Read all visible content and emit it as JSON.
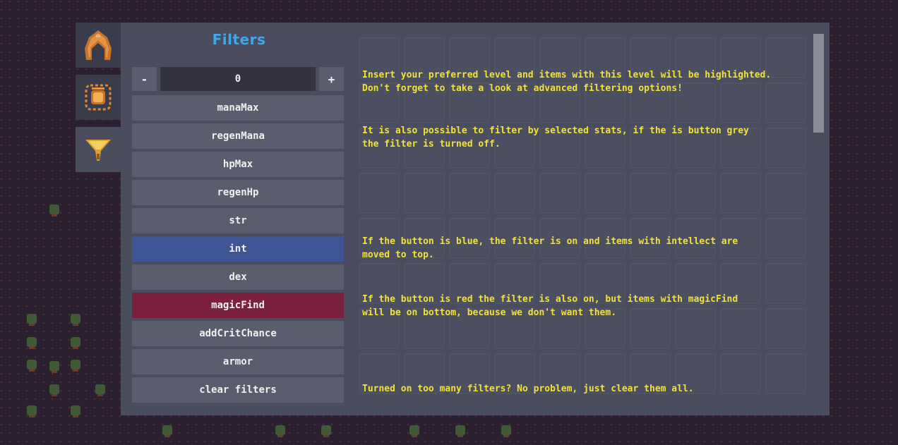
{
  "filters_title": "Filters",
  "level": {
    "minus_label": "-",
    "value": "0",
    "plus_label": "+"
  },
  "filter_buttons": [
    {
      "label": "manaMax",
      "state": "off"
    },
    {
      "label": "regenMana",
      "state": "off"
    },
    {
      "label": "hpMax",
      "state": "off"
    },
    {
      "label": "regenHp",
      "state": "off"
    },
    {
      "label": "str",
      "state": "off"
    },
    {
      "label": "int",
      "state": "on"
    },
    {
      "label": "dex",
      "state": "off"
    },
    {
      "label": "magicFind",
      "state": "excluded"
    },
    {
      "label": "addCritChance",
      "state": "off"
    },
    {
      "label": "armor",
      "state": "off"
    }
  ],
  "clear_label": "clear filters",
  "help_texts": [
    "Insert your preferred level and items with this level will be highlighted.\nDon't forget to take a look at advanced filtering options!",
    "It is also possible to filter by selected stats, if the is button grey\nthe filter is turned off.",
    "If the button is blue, the filter is on and items with intellect are\nmoved to top.",
    "If the button is red the filter is also on, but items with magicFind\nwill be on bottom, because we don't want them.",
    "Turned on too many filters? No problem, just clear them all."
  ],
  "side_tabs": [
    {
      "icon": "helmet-icon",
      "active": false
    },
    {
      "icon": "amulet-icon",
      "active": false
    },
    {
      "icon": "filter-funnel-icon",
      "active": true
    }
  ],
  "colors": {
    "title": "#3ea8e8",
    "help_text": "#f2e13a",
    "button_off": "#5a5d6e",
    "button_on": "#3f5595",
    "button_excluded": "#7c2040"
  }
}
